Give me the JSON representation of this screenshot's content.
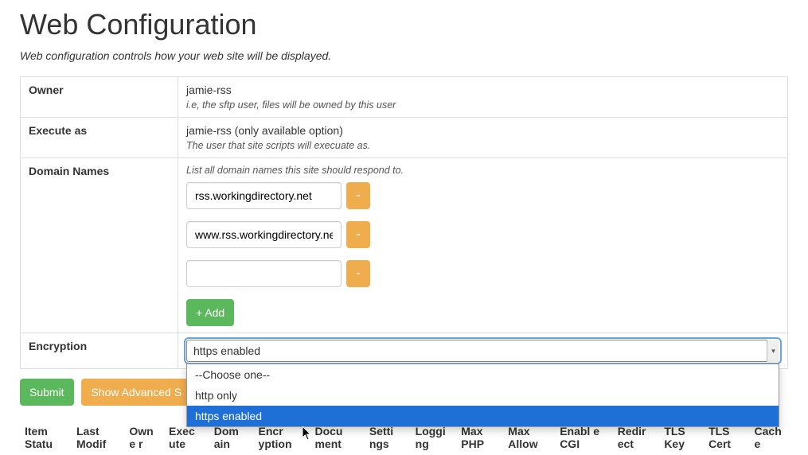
{
  "page": {
    "title": "Web Configuration",
    "subtitle": "Web configuration controls how your web site will be displayed."
  },
  "form": {
    "owner": {
      "label": "Owner",
      "value": "jamie-rss",
      "hint": "i.e, the sftp user, files will be owned by this user"
    },
    "execute_as": {
      "label": "Execute as",
      "value": "jamie-rss (only available option)",
      "hint": "The user that site scripts will execuate as."
    },
    "domains": {
      "label": "Domain Names",
      "hint": "List all domain names this site should respond to.",
      "items": [
        {
          "value": "rss.workingdirectory.net",
          "remove": "-"
        },
        {
          "value": "www.rss.workingdirectory.net",
          "remove": "-"
        },
        {
          "value": "",
          "remove": "-"
        }
      ],
      "add_label": "+ Add"
    },
    "encryption": {
      "label": "Encryption",
      "selected": "https enabled",
      "options": [
        {
          "label": "--Choose one--",
          "highlight": false
        },
        {
          "label": "http only",
          "highlight": false
        },
        {
          "label": "https enabled",
          "highlight": true
        }
      ]
    }
  },
  "actions": {
    "submit": "Submit",
    "advanced": "Show Advanced S"
  },
  "columns": [
    "Item Statu",
    "Last Modif",
    "Owne r",
    "Exec ute",
    "Dom ain",
    "Encr yption",
    "Docu ment",
    "Setti ngs",
    "Loggi ng",
    "Max PHP",
    "Max Allow",
    "Enabl e CGI",
    "Redir ect",
    "TLS Key",
    "TLS Cert",
    "Cach e"
  ]
}
